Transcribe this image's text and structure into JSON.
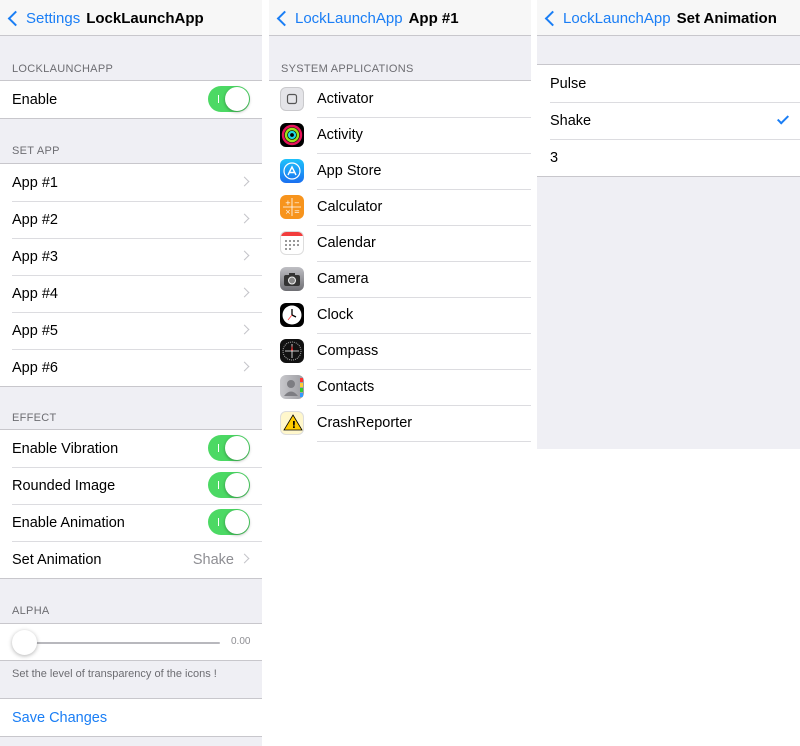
{
  "panel1": {
    "back_label": "Settings",
    "title": "LockLaunchApp",
    "section_main": "LOCKLAUNCHAPP",
    "enable_label": "Enable",
    "section_setapp": "SET APP",
    "apps": [
      "App #1",
      "App #2",
      "App #3",
      "App #4",
      "App #5",
      "App #6"
    ],
    "section_effect": "EFFECT",
    "effect_rows": [
      "Enable Vibration",
      "Rounded Image",
      "Enable Animation"
    ],
    "set_animation_label": "Set Animation",
    "set_animation_value": "Shake",
    "section_alpha": "ALPHA",
    "alpha_value_text": "0.00",
    "alpha_value": 0,
    "alpha_footnote": "Set the level of transparency of the icons !",
    "save_label": "Save Changes",
    "toggle_color": "#4cd964"
  },
  "panel2": {
    "back_label": "LockLaunchApp",
    "title": "App #1",
    "section": "SYSTEM APPLICATIONS",
    "apps": [
      {
        "label": "Activator",
        "icon": "activator-icon"
      },
      {
        "label": "Activity",
        "icon": "activity-icon"
      },
      {
        "label": "App Store",
        "icon": "app-store-icon"
      },
      {
        "label": "Calculator",
        "icon": "calculator-icon"
      },
      {
        "label": "Calendar",
        "icon": "calendar-icon"
      },
      {
        "label": "Camera",
        "icon": "camera-icon"
      },
      {
        "label": "Clock",
        "icon": "clock-icon"
      },
      {
        "label": "Compass",
        "icon": "compass-icon"
      },
      {
        "label": "Contacts",
        "icon": "contacts-icon"
      },
      {
        "label": "CrashReporter",
        "icon": "crash-reporter-icon"
      }
    ]
  },
  "panel3": {
    "back_label": "LockLaunchApp",
    "title": "Set Animation",
    "options": [
      "Pulse",
      "Shake",
      "3"
    ],
    "selected": "Shake"
  },
  "accent_color": "#1a7ef5"
}
